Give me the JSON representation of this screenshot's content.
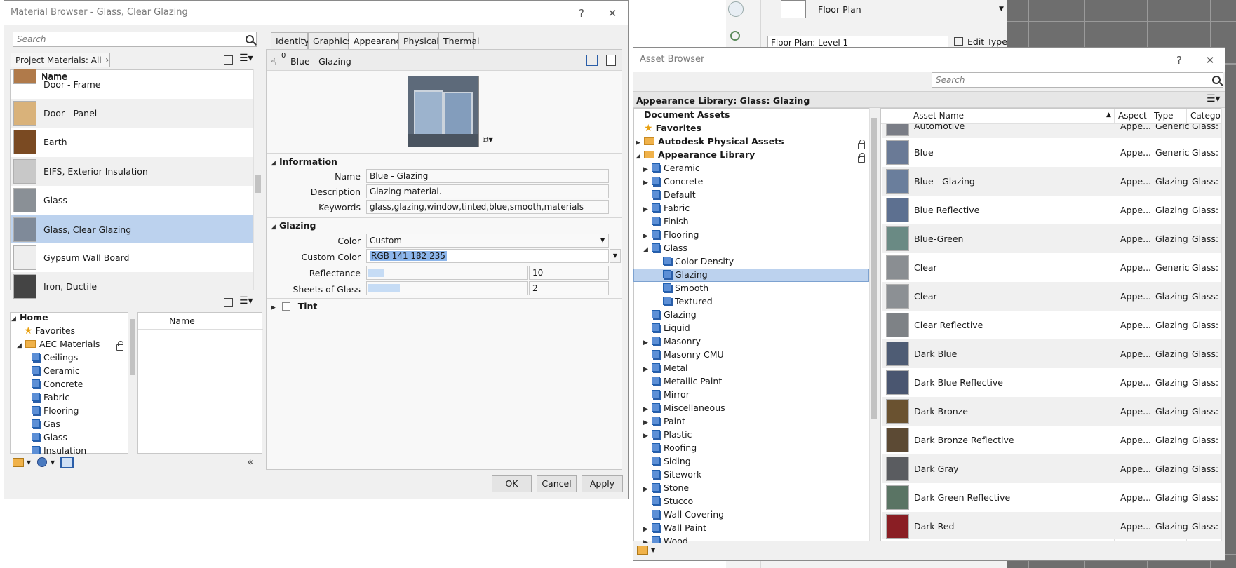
{
  "revit": {
    "view_type": "Floor Plan",
    "view_dropdown": "Floor Plan: Level 1",
    "edit_type": "Edit Type"
  },
  "material_browser": {
    "title": "Material Browser - Glass, Clear Glazing",
    "help": "?",
    "close": "✕",
    "search_placeholder": "Search",
    "filter": "Project Materials: All",
    "column_name": "Name",
    "materials": [
      {
        "label": "Door - Frame",
        "color": "#b07a4a"
      },
      {
        "label": "Door - Panel",
        "color": "#d9b27a"
      },
      {
        "label": "Earth",
        "color": "#7a4a22"
      },
      {
        "label": "EIFS, Exterior Insulation",
        "color": "#c8c8c8"
      },
      {
        "label": "Glass",
        "color": "#8a9096"
      },
      {
        "label": "Glass, Clear Glazing",
        "color": "#7f8a99"
      },
      {
        "label": "Gypsum Wall Board",
        "color": "#eeeeee"
      },
      {
        "label": "Iron, Ductile",
        "color": "#444444"
      }
    ],
    "library_tree": {
      "home": "Home",
      "favorites": "Favorites",
      "aec": "AEC Materials",
      "items": [
        "Ceilings",
        "Ceramic",
        "Concrete",
        "Fabric",
        "Flooring",
        "Gas",
        "Glass",
        "Insulation"
      ]
    },
    "library_column_name": "Name",
    "tabs": [
      "Identity",
      "Graphics",
      "Appearance",
      "Physical",
      "Thermal"
    ],
    "asset_name": "Blue - Glazing",
    "asset_count": "0",
    "information": {
      "header": "Information",
      "name_label": "Name",
      "name_value": "Blue - Glazing",
      "description_label": "Description",
      "description_value": "Glazing material.",
      "keywords_label": "Keywords",
      "keywords_value": "glass,glazing,window,tinted,blue,smooth,materials"
    },
    "glazing": {
      "header": "Glazing",
      "color_label": "Color",
      "color_value": "Custom",
      "custom_color_label": "Custom Color",
      "custom_color_value": "RGB 141 182 235",
      "reflectance_label": "Reflectance",
      "reflectance_value": "10",
      "reflectance_fraction": 0.1,
      "sheets_label": "Sheets of Glass",
      "sheets_value": "2",
      "sheets_fraction": 0.2
    },
    "tint": {
      "header": "Tint"
    },
    "buttons": {
      "ok": "OK",
      "cancel": "Cancel",
      "apply": "Apply"
    }
  },
  "asset_browser": {
    "title": "Asset Browser",
    "help": "?",
    "close": "✕",
    "search_placeholder": "Search",
    "library_path": "Appearance Library: Glass: Glazing",
    "tree": [
      {
        "label": "Document Assets",
        "level": 0,
        "kind": "bold",
        "arrow": ""
      },
      {
        "label": "Favorites",
        "level": 0,
        "kind": "star",
        "arrow": ""
      },
      {
        "label": "Autodesk Physical Assets",
        "level": 0,
        "kind": "folder",
        "arrow": "▶"
      },
      {
        "label": "Appearance Library",
        "level": 0,
        "kind": "folder",
        "arrow": "◢"
      },
      {
        "label": "Ceramic",
        "level": 1,
        "kind": "lib",
        "arrow": "▶"
      },
      {
        "label": "Concrete",
        "level": 1,
        "kind": "lib",
        "arrow": "▶"
      },
      {
        "label": "Default",
        "level": 1,
        "kind": "lib",
        "arrow": ""
      },
      {
        "label": "Fabric",
        "level": 1,
        "kind": "lib",
        "arrow": "▶"
      },
      {
        "label": "Finish",
        "level": 1,
        "kind": "lib",
        "arrow": ""
      },
      {
        "label": "Flooring",
        "level": 1,
        "kind": "lib",
        "arrow": "▶"
      },
      {
        "label": "Glass",
        "level": 1,
        "kind": "lib",
        "arrow": "◢"
      },
      {
        "label": "Color Density",
        "level": 2,
        "kind": "lib",
        "arrow": ""
      },
      {
        "label": "Glazing",
        "level": 2,
        "kind": "lib",
        "arrow": "",
        "selected": true
      },
      {
        "label": "Smooth",
        "level": 2,
        "kind": "lib",
        "arrow": ""
      },
      {
        "label": "Textured",
        "level": 2,
        "kind": "lib",
        "arrow": ""
      },
      {
        "label": "Glazing",
        "level": 1,
        "kind": "lib",
        "arrow": ""
      },
      {
        "label": "Liquid",
        "level": 1,
        "kind": "lib",
        "arrow": ""
      },
      {
        "label": "Masonry",
        "level": 1,
        "kind": "lib",
        "arrow": "▶"
      },
      {
        "label": "Masonry CMU",
        "level": 1,
        "kind": "lib",
        "arrow": ""
      },
      {
        "label": "Metal",
        "level": 1,
        "kind": "lib",
        "arrow": "▶"
      },
      {
        "label": "Metallic Paint",
        "level": 1,
        "kind": "lib",
        "arrow": ""
      },
      {
        "label": "Mirror",
        "level": 1,
        "kind": "lib",
        "arrow": ""
      },
      {
        "label": "Miscellaneous",
        "level": 1,
        "kind": "lib",
        "arrow": "▶"
      },
      {
        "label": "Paint",
        "level": 1,
        "kind": "lib",
        "arrow": "▶"
      },
      {
        "label": "Plastic",
        "level": 1,
        "kind": "lib",
        "arrow": "▶"
      },
      {
        "label": "Roofing",
        "level": 1,
        "kind": "lib",
        "arrow": ""
      },
      {
        "label": "Siding",
        "level": 1,
        "kind": "lib",
        "arrow": ""
      },
      {
        "label": "Sitework",
        "level": 1,
        "kind": "lib",
        "arrow": ""
      },
      {
        "label": "Stone",
        "level": 1,
        "kind": "lib",
        "arrow": "▶"
      },
      {
        "label": "Stucco",
        "level": 1,
        "kind": "lib",
        "arrow": ""
      },
      {
        "label": "Wall Covering",
        "level": 1,
        "kind": "lib",
        "arrow": ""
      },
      {
        "label": "Wall Paint",
        "level": 1,
        "kind": "lib",
        "arrow": "▶"
      },
      {
        "label": "Wood",
        "level": 1,
        "kind": "lib",
        "arrow": "▶"
      }
    ],
    "columns": {
      "name": "Asset Name",
      "aspect": "Aspect",
      "type": "Type",
      "category": "Categor"
    },
    "assets": [
      {
        "name": "Automotive",
        "aspect": "Appe...",
        "type": "Generic",
        "category": "Glass: G",
        "color": "#7a7d86"
      },
      {
        "name": "Blue",
        "aspect": "Appe...",
        "type": "Generic",
        "category": "Glass: G",
        "color": "#6a7a96"
      },
      {
        "name": "Blue - Glazing",
        "aspect": "Appe...",
        "type": "Glazing",
        "category": "Glass: G",
        "color": "#6a7e9c"
      },
      {
        "name": "Blue Reflective",
        "aspect": "Appe...",
        "type": "Glazing",
        "category": "Glass: G",
        "color": "#5d7090"
      },
      {
        "name": "Blue-Green",
        "aspect": "Appe...",
        "type": "Glazing",
        "category": "Glass: G",
        "color": "#6a8a84"
      },
      {
        "name": "Clear",
        "aspect": "Appe...",
        "type": "Generic",
        "category": "Glass: G",
        "color": "#8a8e92"
      },
      {
        "name": "Clear",
        "aspect": "Appe...",
        "type": "Glazing",
        "category": "Glass: G",
        "color": "#8c9094"
      },
      {
        "name": "Clear Reflective",
        "aspect": "Appe...",
        "type": "Glazing",
        "category": "Glass: G",
        "color": "#7e8286"
      },
      {
        "name": "Dark Blue",
        "aspect": "Appe...",
        "type": "Glazing",
        "category": "Glass: G",
        "color": "#4e5c74"
      },
      {
        "name": "Dark Blue Reflective",
        "aspect": "Appe...",
        "type": "Glazing",
        "category": "Glass: G",
        "color": "#4a5670"
      },
      {
        "name": "Dark Bronze",
        "aspect": "Appe...",
        "type": "Glazing",
        "category": "Glass: G",
        "color": "#6a5230"
      },
      {
        "name": "Dark Bronze Reflective",
        "aspect": "Appe...",
        "type": "Glazing",
        "category": "Glass: G",
        "color": "#5c4a34"
      },
      {
        "name": "Dark Gray",
        "aspect": "Appe...",
        "type": "Glazing",
        "category": "Glass: G",
        "color": "#5a5c60"
      },
      {
        "name": "Dark Green Reflective",
        "aspect": "Appe...",
        "type": "Glazing",
        "category": "Glass: G",
        "color": "#5a7464"
      },
      {
        "name": "Dark Red",
        "aspect": "Appe...",
        "type": "Glazing",
        "category": "Glass: G",
        "color": "#8a1e24"
      }
    ]
  }
}
